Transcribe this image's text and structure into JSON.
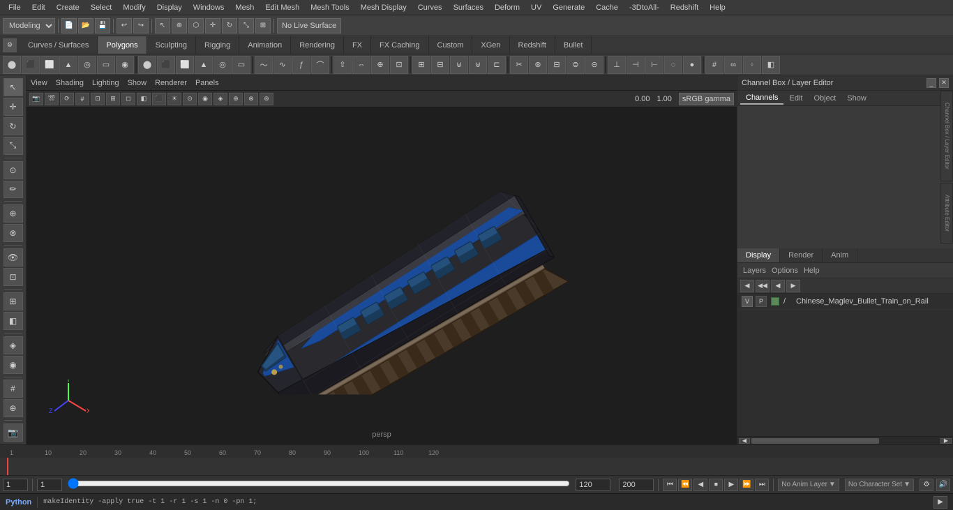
{
  "menuBar": {
    "items": [
      "File",
      "Edit",
      "Create",
      "Select",
      "Modify",
      "Display",
      "Windows",
      "Mesh",
      "Edit Mesh",
      "Mesh Tools",
      "Mesh Display",
      "Curves",
      "Surfaces",
      "Deform",
      "UV",
      "Generate",
      "Cache",
      "-3DtoAll-",
      "Redshift",
      "Help"
    ]
  },
  "toolbar": {
    "mode": "Modeling",
    "live_surface": "No Live Surface"
  },
  "workflowTabs": [
    "Curves / Surfaces",
    "Polygons",
    "Sculpting",
    "Rigging",
    "Animation",
    "Rendering",
    "FX",
    "FX Caching",
    "Custom",
    "XGen",
    "Redshift",
    "Bullet"
  ],
  "viewport": {
    "menus": [
      "View",
      "Shading",
      "Lighting",
      "Show",
      "Renderer",
      "Panels"
    ],
    "persp_label": "persp",
    "gamma": "sRGB gamma",
    "rotation": "0.00",
    "scale": "1.00"
  },
  "rightPanel": {
    "title": "Channel Box / Layer Editor",
    "tabs": [
      "Channels",
      "Edit",
      "Object",
      "Show"
    ],
    "displayTabs": [
      "Display",
      "Render",
      "Anim"
    ],
    "layersTabs": [
      "Layers",
      "Options",
      "Help"
    ],
    "layerRow": {
      "v": "V",
      "p": "P",
      "name": "Chinese_Maglev_Bullet_Train_on_Rail"
    }
  },
  "timeline": {
    "start": "1",
    "end": "120",
    "playback_end": "120",
    "max_frame": "200",
    "current_frame": "1",
    "marks": [
      "1",
      "10",
      "20",
      "30",
      "40",
      "50",
      "60",
      "70",
      "80",
      "90",
      "100",
      "110",
      "120"
    ]
  },
  "bottomBar": {
    "frame_current": "1",
    "frame_sub": "1",
    "anim_layer": "No Anim Layer",
    "char_set": "No Character Set",
    "range_start": "120",
    "range_end": "200"
  },
  "statusBar": {
    "command": "makeIdentity -apply true -t 1 -r 1 -s 1 -n 0 -pn 1;",
    "python_label": "Python"
  },
  "edgeTabs": [
    "Channel Box / Layer Editor",
    "Attribute Editor"
  ],
  "rightEdgeTabs": [
    "Channel Box /\nLayer Editor",
    "Attribute Editor"
  ]
}
